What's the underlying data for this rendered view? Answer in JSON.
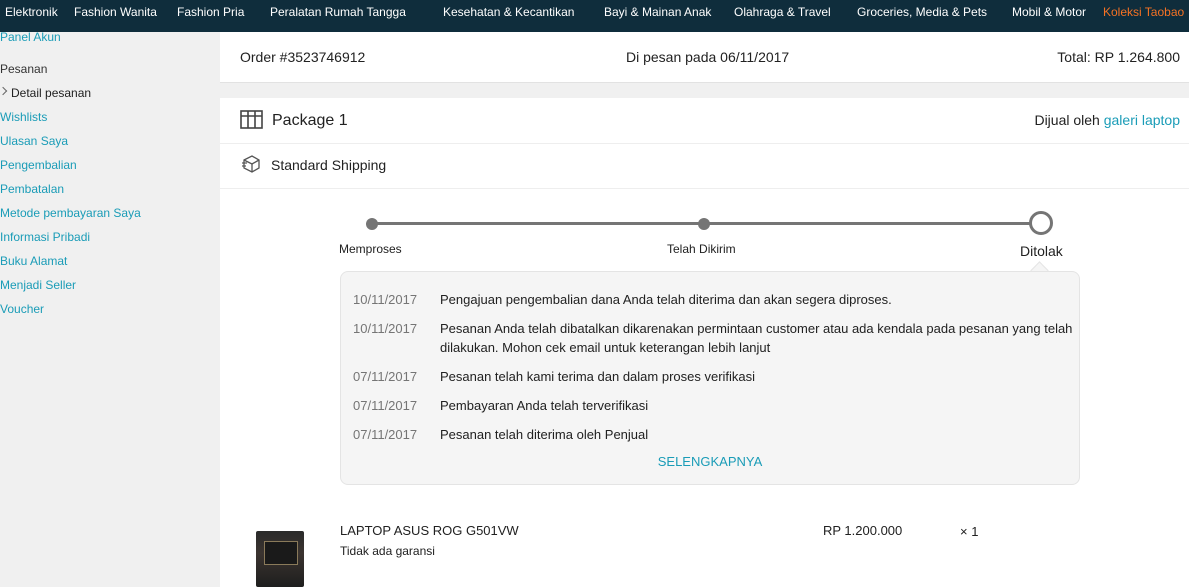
{
  "topnav": {
    "categories": [
      "Elektronik",
      "Fashion Wanita",
      "Fashion Pria",
      "Peralatan Rumah Tangga",
      "Kesehatan & Kecantikan",
      "Bayi & Mainan Anak",
      "Olahraga & Travel",
      "Groceries, Media & Pets",
      "Mobil & Motor",
      "Koleksi Taobao"
    ]
  },
  "sidebar": {
    "panel_akun": "Panel Akun",
    "pesanan": "Pesanan",
    "detail_pesanan": "Detail pesanan",
    "wishlists": "Wishlists",
    "ulasan": "Ulasan Saya",
    "pengembalian": "Pengembalian",
    "pembatalan": "Pembatalan",
    "metode_pembayaran": "Metode pembayaran Saya",
    "informasi_pribadi": "Informasi Pribadi",
    "buku_alamat": "Buku Alamat",
    "menjadi_seller": "Menjadi Seller",
    "voucher": "Voucher"
  },
  "order": {
    "number": "Order #3523746912",
    "date": "Di pesan pada 06/11/2017",
    "total": "Total: RP 1.264.800"
  },
  "package": {
    "title": "Package 1",
    "sold_by_label": "Dijual oleh",
    "seller": "galeri laptop",
    "shipping": "Standard Shipping",
    "icons": {
      "package": "package-icon",
      "shipping": "shipping-box-icon"
    }
  },
  "timeline": {
    "steps": [
      "Memproses",
      "Telah Dikirim",
      "Ditolak"
    ],
    "current_step": "Ditolak"
  },
  "history": {
    "entries": [
      {
        "date": "10/11/2017",
        "text": "Pengajuan pengembalian dana Anda telah diterima dan akan segera diproses."
      },
      {
        "date": "10/11/2017",
        "text": "Pesanan Anda telah dibatalkan dikarenakan permintaan customer atau ada kendala pada pesanan yang telah dilakukan. Mohon cek email untuk keterangan lebih lanjut"
      },
      {
        "date": "07/11/2017",
        "text": "Pesanan telah kami terima dan dalam proses verifikasi"
      },
      {
        "date": "07/11/2017",
        "text": "Pembayaran Anda telah terverifikasi"
      },
      {
        "date": "07/11/2017",
        "text": "Pesanan telah diterima oleh Penjual"
      }
    ],
    "more_label": "SELENGKAPNYA"
  },
  "product": {
    "name": "LAPTOP ASUS ROG G501VW",
    "warranty": "Tidak ada garansi",
    "price": "RP 1.200.000",
    "qty": "× 1"
  },
  "colors": {
    "topbar_bg": "#0f2d3c",
    "link": "#1a9cb7",
    "highlight_category": "#f57224",
    "timeline": "#757575"
  }
}
